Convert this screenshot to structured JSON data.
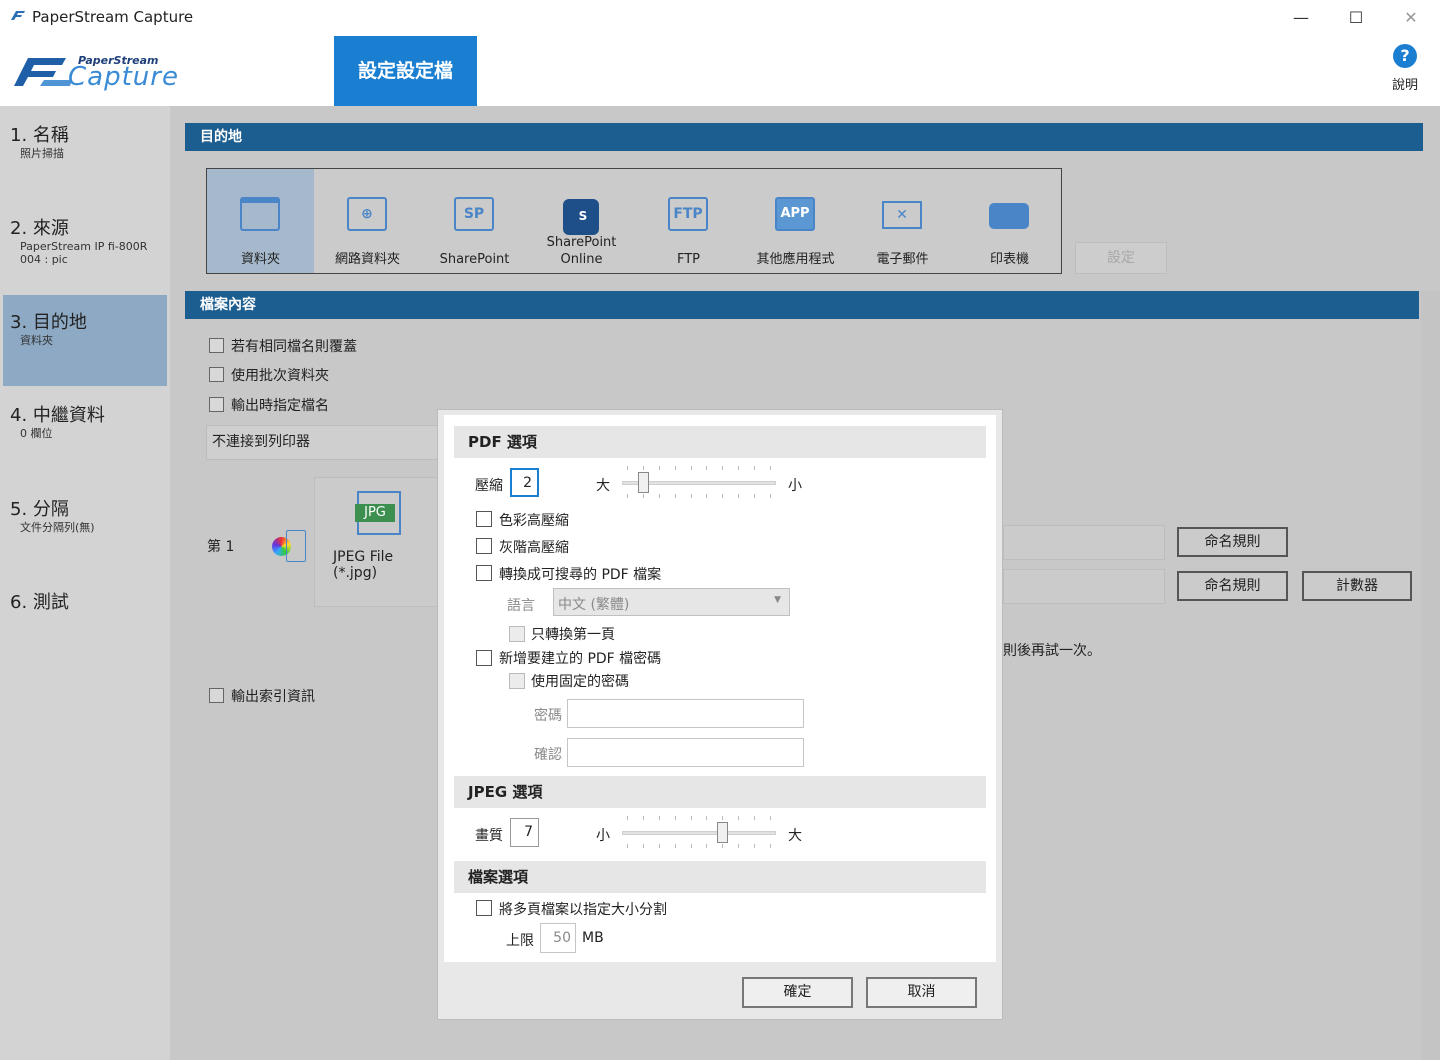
{
  "window": {
    "title": "PaperStream Capture",
    "controls": [
      "—",
      "☐",
      "✕"
    ]
  },
  "header": {
    "logo_top": "PaperStream",
    "logo_main": "Capture",
    "active_tab": "設定設定檔",
    "help_label": "說明"
  },
  "sidebar": {
    "steps": [
      {
        "title": "1. 名稱",
        "sub": "照片掃描"
      },
      {
        "title": "2. 來源",
        "sub": "PaperStream IP fi-800R",
        "sub2": "004 : pic"
      },
      {
        "title": "3. 目的地",
        "sub": "資料夾"
      },
      {
        "title": "4. 中繼資料",
        "sub": "0 欄位"
      },
      {
        "title": "5. 分隔",
        "sub": "文件分隔列(無)"
      },
      {
        "title": "6. 測試",
        "sub": ""
      }
    ]
  },
  "destination": {
    "section_title": "目的地",
    "items": [
      {
        "label": "資料夾",
        "icon": "folder-icon"
      },
      {
        "label": "網路資料夾",
        "icon": "network-folder-icon"
      },
      {
        "label": "SharePoint",
        "icon": "sharepoint-icon",
        "icon_text": "SP"
      },
      {
        "label": "SharePoint",
        "label2": "Online",
        "icon": "sharepoint-online-icon"
      },
      {
        "label": "FTP",
        "icon": "ftp-icon",
        "icon_text": "FTP"
      },
      {
        "label": "其他應用程式",
        "icon": "app-icon",
        "icon_text": "APP"
      },
      {
        "label": "電子郵件",
        "icon": "mail-icon"
      },
      {
        "label": "印表機",
        "icon": "printer-icon"
      }
    ],
    "settings_button": "設定"
  },
  "file_content": {
    "section_title": "檔案內容",
    "overwrite_label": "若有相同檔名則覆蓋",
    "batch_folder_label": "使用批次資料夾",
    "specify_name_label": "輸出時指定檔名",
    "printer_select": "不連接到列印器",
    "page_label": "第 1",
    "file_type_badge": "JPG",
    "file_type_label": "JPEG File (*.jpg)",
    "naming_rule_1": "命名規則",
    "naming_rule_2": "命名規則",
    "counter_button": "計數器",
    "retry_text": "則後再試一次。",
    "index_label": "輸出索引資訊"
  },
  "dialog": {
    "pdf_section": "PDF 選項",
    "compression_label": "壓縮",
    "compression_value": "2",
    "compression_min_label": "大",
    "compression_max_label": "小",
    "compression_level": 2,
    "color_high_compression": "色彩高壓縮",
    "gray_high_compression": "灰階高壓縮",
    "searchable_pdf": "轉換成可搜尋的 PDF 檔案",
    "language_label": "語言",
    "language_value": "中文 (繁體)",
    "first_page_only": "只轉換第一頁",
    "add_password": "新增要建立的 PDF 檔密碼",
    "fixed_password": "使用固定的密碼",
    "password_label": "密碼",
    "confirm_label": "確認",
    "jpeg_section": "JPEG 選項",
    "quality_label": "畫質",
    "quality_value": "7",
    "quality_min_label": "小",
    "quality_max_label": "大",
    "quality_level": 7,
    "file_section": "檔案選項",
    "split_label": "將多頁檔案以指定大小分割",
    "limit_label": "上限",
    "limit_value": "50",
    "limit_unit": "MB",
    "ok_button": "確定",
    "cancel_button": "取消"
  },
  "colors": {
    "accent": "#1b7fd1",
    "section_bar": "#1d5e90",
    "sidebar_active": "#8da9c4"
  }
}
